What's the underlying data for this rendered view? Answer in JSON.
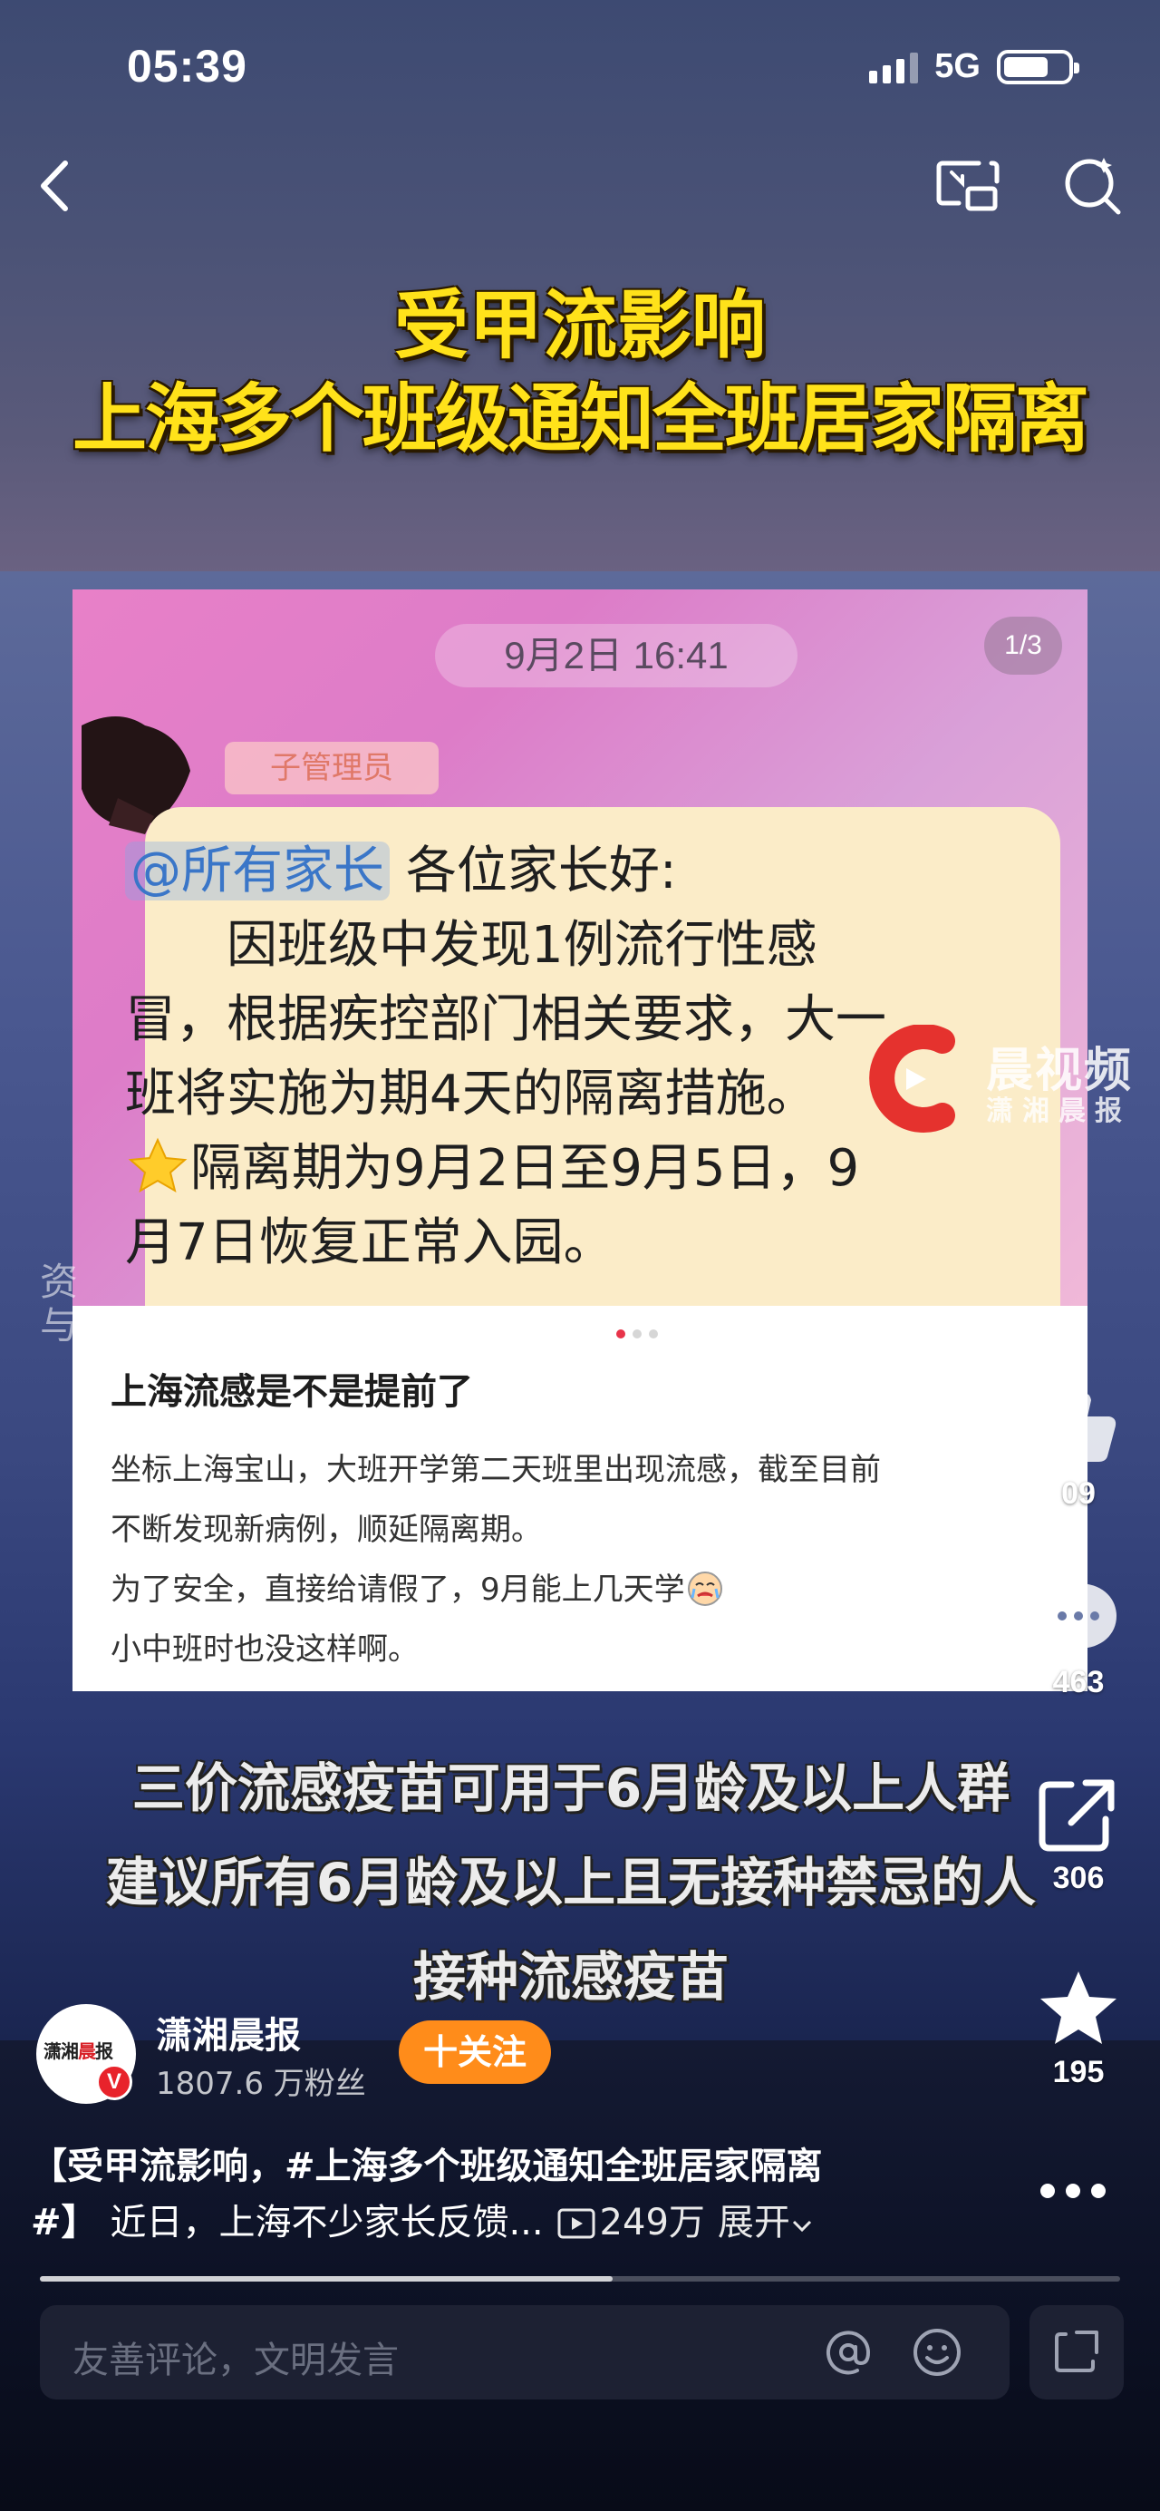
{
  "status_bar": {
    "time": "05:39",
    "network": "5G",
    "battery_level": 0.7
  },
  "headline": {
    "line1": "受甲流影响",
    "line2": "上海多个班级通知全班居家隔离"
  },
  "chat": {
    "date": "9月2日 16:41",
    "page_indicator": "1/3",
    "role_tag": "子管理员",
    "mention": "@所有家长",
    "line1_rest": "各位家长好:",
    "line2": "因班级中发现1例流行性感",
    "line3": "冒，根据疾控部门相关要求，大一",
    "line4": "班将实施为期4天的隔离措施。",
    "line5": "隔离期为9月2日至9月5日，9",
    "line6": "月7日恢复正常入园。"
  },
  "watermark": {
    "text1": "晨视频",
    "text2": "潇湘晨报"
  },
  "side_ghost": {
    "line1": "资",
    "line2": "与"
  },
  "post_card": {
    "title": "上海流感是不是提前了",
    "line1": "坐标上海宝山，大班开学第二天班里出现流感，截至目前",
    "line2": "不断发现新病例，顺延隔离期。",
    "line3": "为了安全，直接给请假了，9月能上几天学",
    "line4": "小中班时也没这样啊。"
  },
  "subtitle": {
    "line1": "三价流感疫苗可用于6月龄及以上人群",
    "line2": "建议所有6月龄及以上且无接种禁忌的人",
    "line3": "接种流感疫苗"
  },
  "rail": {
    "like_count": "09",
    "comment_count": "463",
    "share_count": "306",
    "favorite_count": "195"
  },
  "author": {
    "avatar_text_a": "潇湘",
    "avatar_text_b": "晨",
    "avatar_text_c": "报",
    "verified_mark": "V",
    "name": "潇湘晨报",
    "fans": "1807.6 万粉丝",
    "follow_label": "十关注"
  },
  "caption": {
    "line1": "【受甲流影响，#上海多个班级通知全班居家隔离",
    "line2_bold": "#】",
    "line2_rest": "近日，上海不少家长反馈...",
    "play_count": "249万",
    "expand_label": "展开"
  },
  "progress": {
    "fraction": 0.53
  },
  "comment": {
    "placeholder": "友善评论，文明发言"
  },
  "colors": {
    "headline": "#ffe21a",
    "follow": "#ff8c1a",
    "verified": "#e8232b",
    "mention": "#3a76c8"
  }
}
